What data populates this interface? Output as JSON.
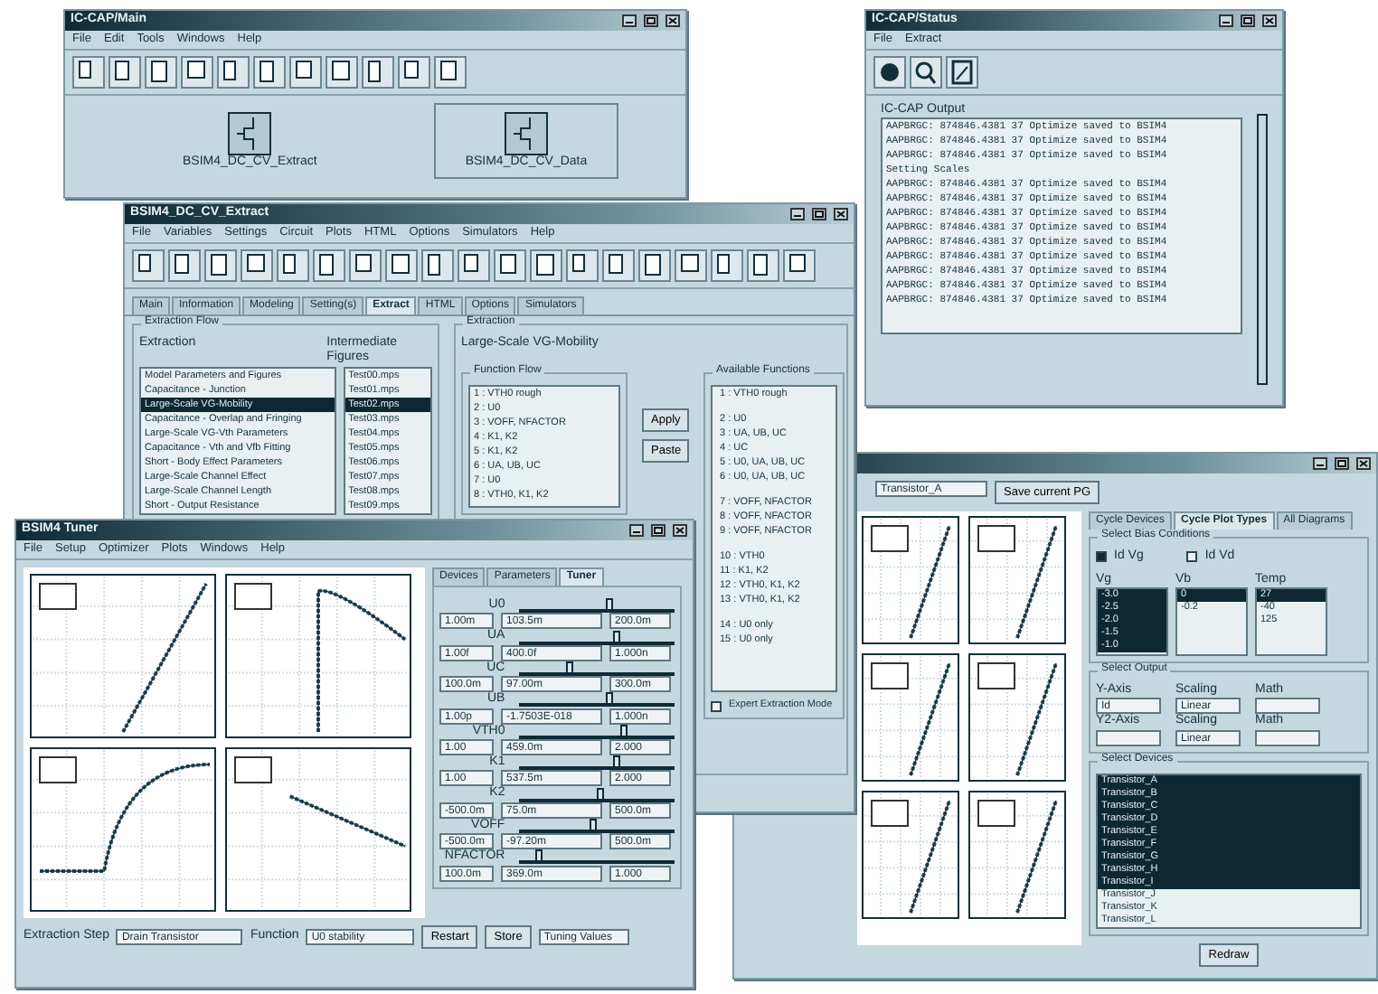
{
  "windows": [
    {
      "kind": "main",
      "title": "IC-CAP/Main",
      "menu": [
        "File",
        "Edit",
        "Tools",
        "Windows",
        "Help"
      ],
      "models": [
        {
          "label": "BSIM4_DC_CV_Extract",
          "selected": false
        },
        {
          "label": "BSIM4_DC_CV_Data",
          "selected": true
        }
      ]
    },
    {
      "kind": "status",
      "title": "IC-CAP/Status",
      "menu": [
        "File",
        "Extract"
      ],
      "output_label": "IC-CAP Output",
      "log": [
        "AAPBRGC: 874846.4381 37 Optimize saved to BSIM4",
        "AAPBRGC: 874846.4381 37 Optimize saved to BSIM4",
        "AAPBRGC: 874846.4381 37 Optimize saved to BSIM4",
        "Setting Scales",
        "AAPBRGC: 874846.4381 37 Optimize saved to BSIM4",
        "AAPBRGC: 874846.4381 37 Optimize saved to BSIM4",
        "AAPBRGC: 874846.4381 37 Optimize saved to BSIM4",
        "AAPBRGC: 874846.4381 37 Optimize saved to BSIM4",
        "AAPBRGC: 874846.4381 37 Optimize saved to BSIM4",
        "AAPBRGC: 874846.4381 37 Optimize saved to BSIM4",
        "AAPBRGC: 874846.4381 37 Optimize saved to BSIM4",
        "AAPBRGC: 874846.4381 37 Optimize saved to BSIM4",
        "AAPBRGC: 874846.4381 37 Optimize saved to BSIM4"
      ]
    },
    {
      "kind": "plots",
      "device_combo": "Transistor_A",
      "save_button": "Save current PG",
      "tabs": [
        {
          "label": "Cycle Devices",
          "selected": false
        },
        {
          "label": "Cycle Plot Types",
          "selected": true
        },
        {
          "label": "All Diagrams",
          "selected": false
        }
      ],
      "bias_title": "Select Bias Conditions",
      "bias_checks": [
        {
          "label": "Id Vg",
          "checked": true
        },
        {
          "label": "Id Vd",
          "checked": false
        }
      ],
      "bias_lists": [
        {
          "header": "Vg",
          "items": [
            {
              "label": "-3.0",
              "selected": true
            },
            {
              "label": "-2.5",
              "selected": true
            },
            {
              "label": "-2.0",
              "selected": true
            },
            {
              "label": "-1.5",
              "selected": true
            },
            {
              "label": "-1.0",
              "selected": true
            }
          ]
        },
        {
          "header": "Vb",
          "items": [
            {
              "label": "0",
              "selected": true
            },
            {
              "label": "-0.2",
              "selected": false
            }
          ]
        },
        {
          "header": "Temp",
          "items": [
            {
              "label": "27",
              "selected": true
            },
            {
              "label": "-40",
              "selected": false
            },
            {
              "label": "125",
              "selected": false
            }
          ]
        }
      ],
      "output_title": "Select Output",
      "outputs": [
        {
          "axis": "Y-Axis",
          "axis_value": "Id",
          "scaling": "Scaling",
          "scaling_value": "Linear",
          "math": "Math"
        },
        {
          "axis": "Y2-Axis",
          "scaling": "Scaling",
          "scaling_value": "Linear",
          "math": "Math"
        }
      ],
      "devices_title": "Select Devices",
      "devices": [
        {
          "label": "Transistor_A",
          "selected": true
        },
        {
          "label": "Transistor_B",
          "selected": true
        },
        {
          "label": "Transistor_C",
          "selected": true
        },
        {
          "label": "Transistor_D",
          "selected": true
        },
        {
          "label": "Transistor_E",
          "selected": true
        },
        {
          "label": "Transistor_F",
          "selected": true
        },
        {
          "label": "Transistor_G",
          "selected": true
        },
        {
          "label": "Transistor_H",
          "selected": true
        },
        {
          "label": "Transistor_I",
          "selected": true
        },
        {
          "label": "Transistor_J",
          "selected": false
        },
        {
          "label": "Transistor_K",
          "selected": false
        },
        {
          "label": "Transistor_L",
          "selected": false
        }
      ],
      "redraw_button": "Redraw"
    },
    {
      "kind": "extract",
      "title": "BSIM4_DC_CV_Extract",
      "menu": [
        "File",
        "Variables",
        "Settings",
        "Circuit",
        "Plots",
        "HTML",
        "Options",
        "Simulators",
        "Help"
      ],
      "tabs": [
        {
          "label": "Main",
          "selected": false
        },
        {
          "label": "Information",
          "selected": false
        },
        {
          "label": "Modeling",
          "selected": false
        },
        {
          "label": "Setting(s)",
          "selected": false
        },
        {
          "label": "Extract",
          "selected": true
        },
        {
          "label": "HTML",
          "selected": false
        },
        {
          "label": "Options",
          "selected": false
        },
        {
          "label": "Simulators",
          "selected": false
        }
      ],
      "flow_title": "Extraction Flow",
      "flow_headers": [
        "Extraction",
        "Intermediate Figures"
      ],
      "steps": [
        {
          "label": "Model Parameters and Figures",
          "figure": "Test00.mps",
          "selected": false
        },
        {
          "label": "Capacitance - Junction",
          "figure": "Test01.mps",
          "selected": false
        },
        {
          "label": "Large-Scale VG-Mobility",
          "figure": "Test02.mps",
          "selected": true
        },
        {
          "label": "Capacitance - Overlap and Fringing",
          "figure": "Test03.mps",
          "selected": false
        },
        {
          "label": "Large-Scale VG-Vth Parameters",
          "figure": "Test04.mps",
          "selected": false
        },
        {
          "label": "Capacitance - Vth and Vfb Fitting",
          "figure": "Test05.mps",
          "selected": false
        },
        {
          "label": "Short - Body Effect Parameters",
          "figure": "Test06.mps",
          "selected": false
        },
        {
          "label": "Large-Scale Channel Effect",
          "figure": "Test07.mps",
          "selected": false
        },
        {
          "label": "Large-Scale Channel Length",
          "figure": "Test08.mps",
          "selected": false
        },
        {
          "label": "Short - Output Resistance",
          "figure": "Test09.mps",
          "selected": false
        }
      ],
      "extraction_title": "Extraction",
      "extraction_name": "Large-Scale VG-Mobility",
      "function_flow_title": "Function Flow",
      "function_flow": [
        "1 : VTH0 rough",
        "2 : U0",
        "3 : VOFF, NFACTOR",
        "4 : K1, K2",
        "5 : K1, K2",
        "6 : UA, UB, UC",
        "7 : U0",
        "8 : VTH0, K1, K2"
      ],
      "available_title": "Available Functions",
      "available_groups": [
        [
          "1 : VTH0 rough"
        ],
        [
          "2 : U0",
          "3 : UA, UB, UC",
          "4 : UC",
          "5 : U0, UA, UB, UC",
          "6 : U0, UA, UB, UC"
        ],
        [
          "7 : VOFF, NFACTOR",
          "8 : VOFF, NFACTOR",
          "9 : VOFF, NFACTOR"
        ],
        [
          "10 : VTH0",
          "11 : K1, K2",
          "12 : VTH0, K1, K2",
          "13 : VTH0, K1, K2"
        ],
        [
          "14 : U0 only",
          "15 : U0 only"
        ]
      ],
      "apply_button": "Apply",
      "paste_button": "Paste",
      "expert_check": {
        "label": "Expert Extraction Mode",
        "checked": false
      }
    },
    {
      "kind": "tuner",
      "title": "BSIM4 Tuner",
      "menu": [
        "File",
        "Setup",
        "Optimizer",
        "Plots",
        "Windows",
        "Help"
      ],
      "tabs": [
        {
          "label": "Devices",
          "selected": false
        },
        {
          "label": "Parameters",
          "selected": false
        },
        {
          "label": "Tuner",
          "selected": true
        }
      ],
      "params": [
        {
          "name": "U0",
          "level": 0.55,
          "min": "1.00m",
          "value": "103.5m",
          "max": "200.0m"
        },
        {
          "name": "UA",
          "level": 0.6,
          "min": "1.00f",
          "value": "400.0f",
          "max": "1.000n"
        },
        {
          "name": "UC",
          "level": 0.3,
          "min": "100.0m",
          "value": "97.00m",
          "max": "300.0m"
        },
        {
          "name": "UB",
          "level": 0.55,
          "min": "1.00p",
          "value": "-1.7503E-018",
          "max": "1.000n"
        },
        {
          "name": "VTH0",
          "level": 0.65,
          "min": "1.00",
          "value": "459.0m",
          "max": "2.000"
        },
        {
          "name": "K1",
          "level": 0.6,
          "min": "1.00",
          "value": "537.5m",
          "max": "2.000"
        },
        {
          "name": "K2",
          "level": 0.5,
          "min": "-500.0m",
          "value": "75.0m",
          "max": "500.0m"
        },
        {
          "name": "VOFF",
          "level": 0.45,
          "min": "-500.0m",
          "value": "-97.20m",
          "max": "500.0m"
        },
        {
          "name": "NFACTOR",
          "level": 0.1,
          "min": "100.0m",
          "value": "369.0m",
          "max": "1.000"
        }
      ],
      "step_label": "Extraction Step",
      "step_value": "Drain Transistor",
      "function_label": "Function",
      "function_value": "U0 stability",
      "buttons": [
        "Restart",
        "Store"
      ],
      "values_combo": "Tuning Values"
    }
  ]
}
